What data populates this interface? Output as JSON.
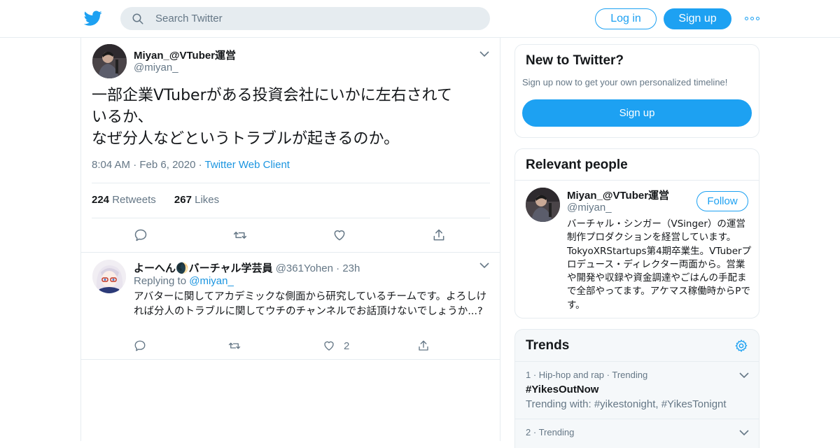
{
  "header": {
    "search_placeholder": "Search Twitter",
    "login_label": "Log in",
    "signup_label": "Sign up",
    "brand_color": "#1da1f2"
  },
  "main_tweet": {
    "name": "Miyan_@VTuber運営",
    "handle": "@miyan_",
    "text_line1": "一部企業VTuberがある投資会社にいかに左右されて",
    "text_line2": "いるか、",
    "text_line3": "なぜ分人などというトラブルが起きるのか。",
    "time": "8:04 AM",
    "date": "Feb 6, 2020",
    "source": "Twitter Web Client",
    "retweets_count": "224",
    "retweets_label": "Retweets",
    "likes_count": "267",
    "likes_label": "Likes"
  },
  "reply": {
    "name": "よーへん🌒バーチャル学芸員",
    "handle": "@361Yohen",
    "time": "23h",
    "replying_prefix": "Replying to",
    "replying_handle": "@miyan_",
    "text": "アバターに関してアカデミックな側面から研究しているチームです。よろしければ分人のトラブルに関してウチのチャンネルでお話頂けないでしょうか...?",
    "like_count": "2"
  },
  "new_to_twitter": {
    "title": "New to Twitter?",
    "subtitle": "Sign up now to get your own personalized timeline!",
    "button": "Sign up"
  },
  "relevant_people": {
    "title": "Relevant people",
    "name": "Miyan_@VTuber運営",
    "handle": "@miyan_",
    "follow_label": "Follow",
    "bio": "バーチャル・シンガー（VSinger）の運営制作プロダクションを経営しています。TokyoXRStartups第4期卒業生。VTuberプロデュース・ディレクター両面から。営業や開発や収録や資金調達やごはんの手配まで全部やってます。アケマス稼働時からPです。"
  },
  "trends": {
    "title": "Trends",
    "items": [
      {
        "rank": "1",
        "category": "Hip-hop and rap",
        "status": "Trending",
        "name": "#YikesOutNow",
        "with": "Trending with: #yikestonight, #YikesTonignt"
      },
      {
        "rank": "2",
        "status": "Trending"
      }
    ]
  },
  "icons": [
    "twitter-logo-icon",
    "search-icon",
    "more-icon",
    "chevron-down-icon",
    "reply-icon",
    "retweet-icon",
    "like-icon",
    "share-icon",
    "gear-icon"
  ]
}
